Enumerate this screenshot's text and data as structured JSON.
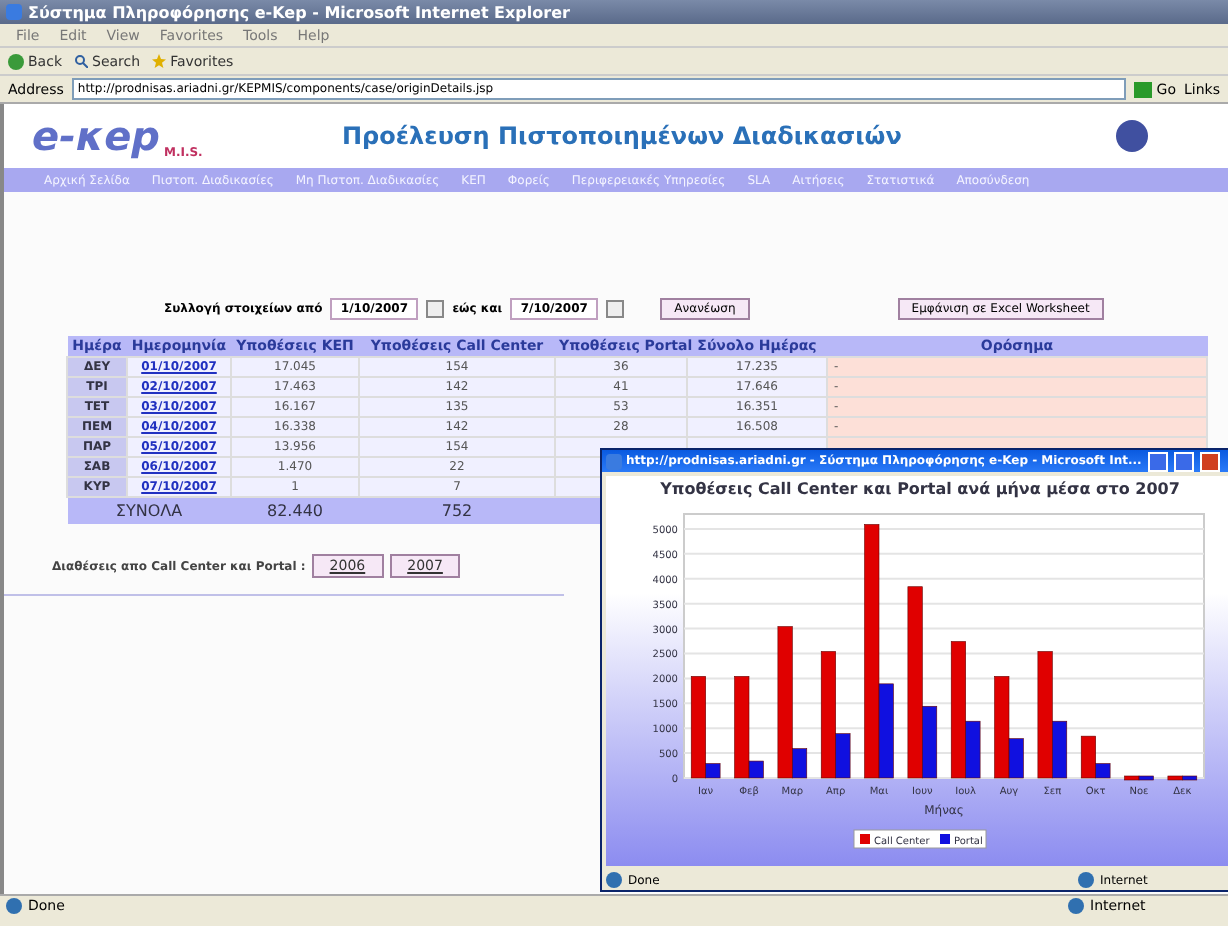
{
  "window": {
    "title": "Σύστημα Πληροφόρησης e-Kep - Microsoft Internet Explorer"
  },
  "menu": [
    "File",
    "Edit",
    "View",
    "Favorites",
    "Tools",
    "Help"
  ],
  "toolbar": {
    "back": "Back",
    "search": "Search",
    "favorites": "Favorites"
  },
  "address": {
    "label": "Address",
    "value": "http://prodnisas.ariadni.gr/KEPMIS/components/case/originDetails.jsp",
    "go": "Go",
    "links": "Links"
  },
  "banner": {
    "logo": "e-κep",
    "logo_sub": "M.I.S.",
    "title": "Προέλευση Πιστοποιημένων Διαδικασιών"
  },
  "nav": [
    "Αρχική Σελίδα",
    "Πιστοπ. Διαδικασίες",
    "Μη Πιστοπ. Διαδικασίες",
    "ΚΕΠ",
    "Φορείς",
    "Περιφερειακές Υπηρεσίες",
    "SLA",
    "Αιτήσεις",
    "Στατιστικά",
    "Αποσύνδεση"
  ],
  "filter": {
    "from_label": "Συλλογή στοιχείων από",
    "from": "1/10/2007",
    "to_label": "εώς και",
    "to": "7/10/2007",
    "refresh": "Ανανέωση",
    "export": "Εμφάνιση σε Excel Worksheet"
  },
  "table": {
    "columns": [
      "Ημέρα",
      "Ημερομηνία",
      "Υποθέσεις ΚΕΠ",
      "Υποθέσεις Call Center",
      "Υποθέσεις Portal",
      "Σύνολο Ημέρας",
      "Ορόσημα"
    ],
    "rows": [
      {
        "day": "ΔΕΥ",
        "date": "01/10/2007",
        "kep": "17.045",
        "call_center": "154",
        "portal": "36",
        "total": "17.235",
        "milestone": "-"
      },
      {
        "day": "ΤΡΙ",
        "date": "02/10/2007",
        "kep": "17.463",
        "call_center": "142",
        "portal": "41",
        "total": "17.646",
        "milestone": "-"
      },
      {
        "day": "ΤΕΤ",
        "date": "03/10/2007",
        "kep": "16.167",
        "call_center": "135",
        "portal": "53",
        "total": "16.351",
        "milestone": "-"
      },
      {
        "day": "ΠΕΜ",
        "date": "04/10/2007",
        "kep": "16.338",
        "call_center": "142",
        "portal": "28",
        "total": "16.508",
        "milestone": "-"
      },
      {
        "day": "ΠΑΡ",
        "date": "05/10/2007",
        "kep": "13.956",
        "call_center": "154"
      },
      {
        "day": "ΣΑΒ",
        "date": "06/10/2007",
        "kep": "1.470",
        "call_center": "22"
      },
      {
        "day": "ΚΥΡ",
        "date": "07/10/2007",
        "kep": "1",
        "call_center": "7"
      }
    ],
    "totals": {
      "label": "ΣΥΝΟΛΑ",
      "kep": "82.440",
      "call_center": "752"
    }
  },
  "comparison": {
    "label": "Διαθέσεις απο Call Center και Portal :",
    "years": [
      "2006",
      "2007"
    ]
  },
  "popup": {
    "title": "http://prodnisas.ariadni.gr - Σύστημα Πληροφόρησης e-Kep - Microsoft Int...",
    "chart_data": {
      "type": "bar",
      "title": "Υποθέσεις Call Center και Portal ανά μήνα μέσα στο 2007",
      "xlabel": "Μήνας",
      "categories": [
        "Ιαν",
        "Φεβ",
        "Μαρ",
        "Απρ",
        "Μαι",
        "Ιουν",
        "Ιουλ",
        "Αυγ",
        "Σεπ",
        "Οκτ",
        "Νοε",
        "Δεκ"
      ],
      "series": [
        {
          "name": "Call Center",
          "color": "#e00000",
          "values": [
            2000,
            2000,
            3000,
            2500,
            5050,
            3800,
            2700,
            2000,
            2500,
            800,
            0,
            0
          ]
        },
        {
          "name": "Portal",
          "color": "#1010e0",
          "values": [
            250,
            300,
            550,
            850,
            1850,
            1400,
            1100,
            750,
            1100,
            250,
            0,
            0
          ]
        }
      ],
      "ylim": [
        0,
        5300
      ],
      "grid": true,
      "legend": true,
      "yticks": [
        0,
        500,
        1000,
        1500,
        2000,
        2500,
        3000,
        3500,
        4000,
        4500,
        5000
      ]
    },
    "status": "Done",
    "zone": "Internet"
  },
  "status_bar": {
    "status": "Done",
    "zone": "Internet"
  }
}
